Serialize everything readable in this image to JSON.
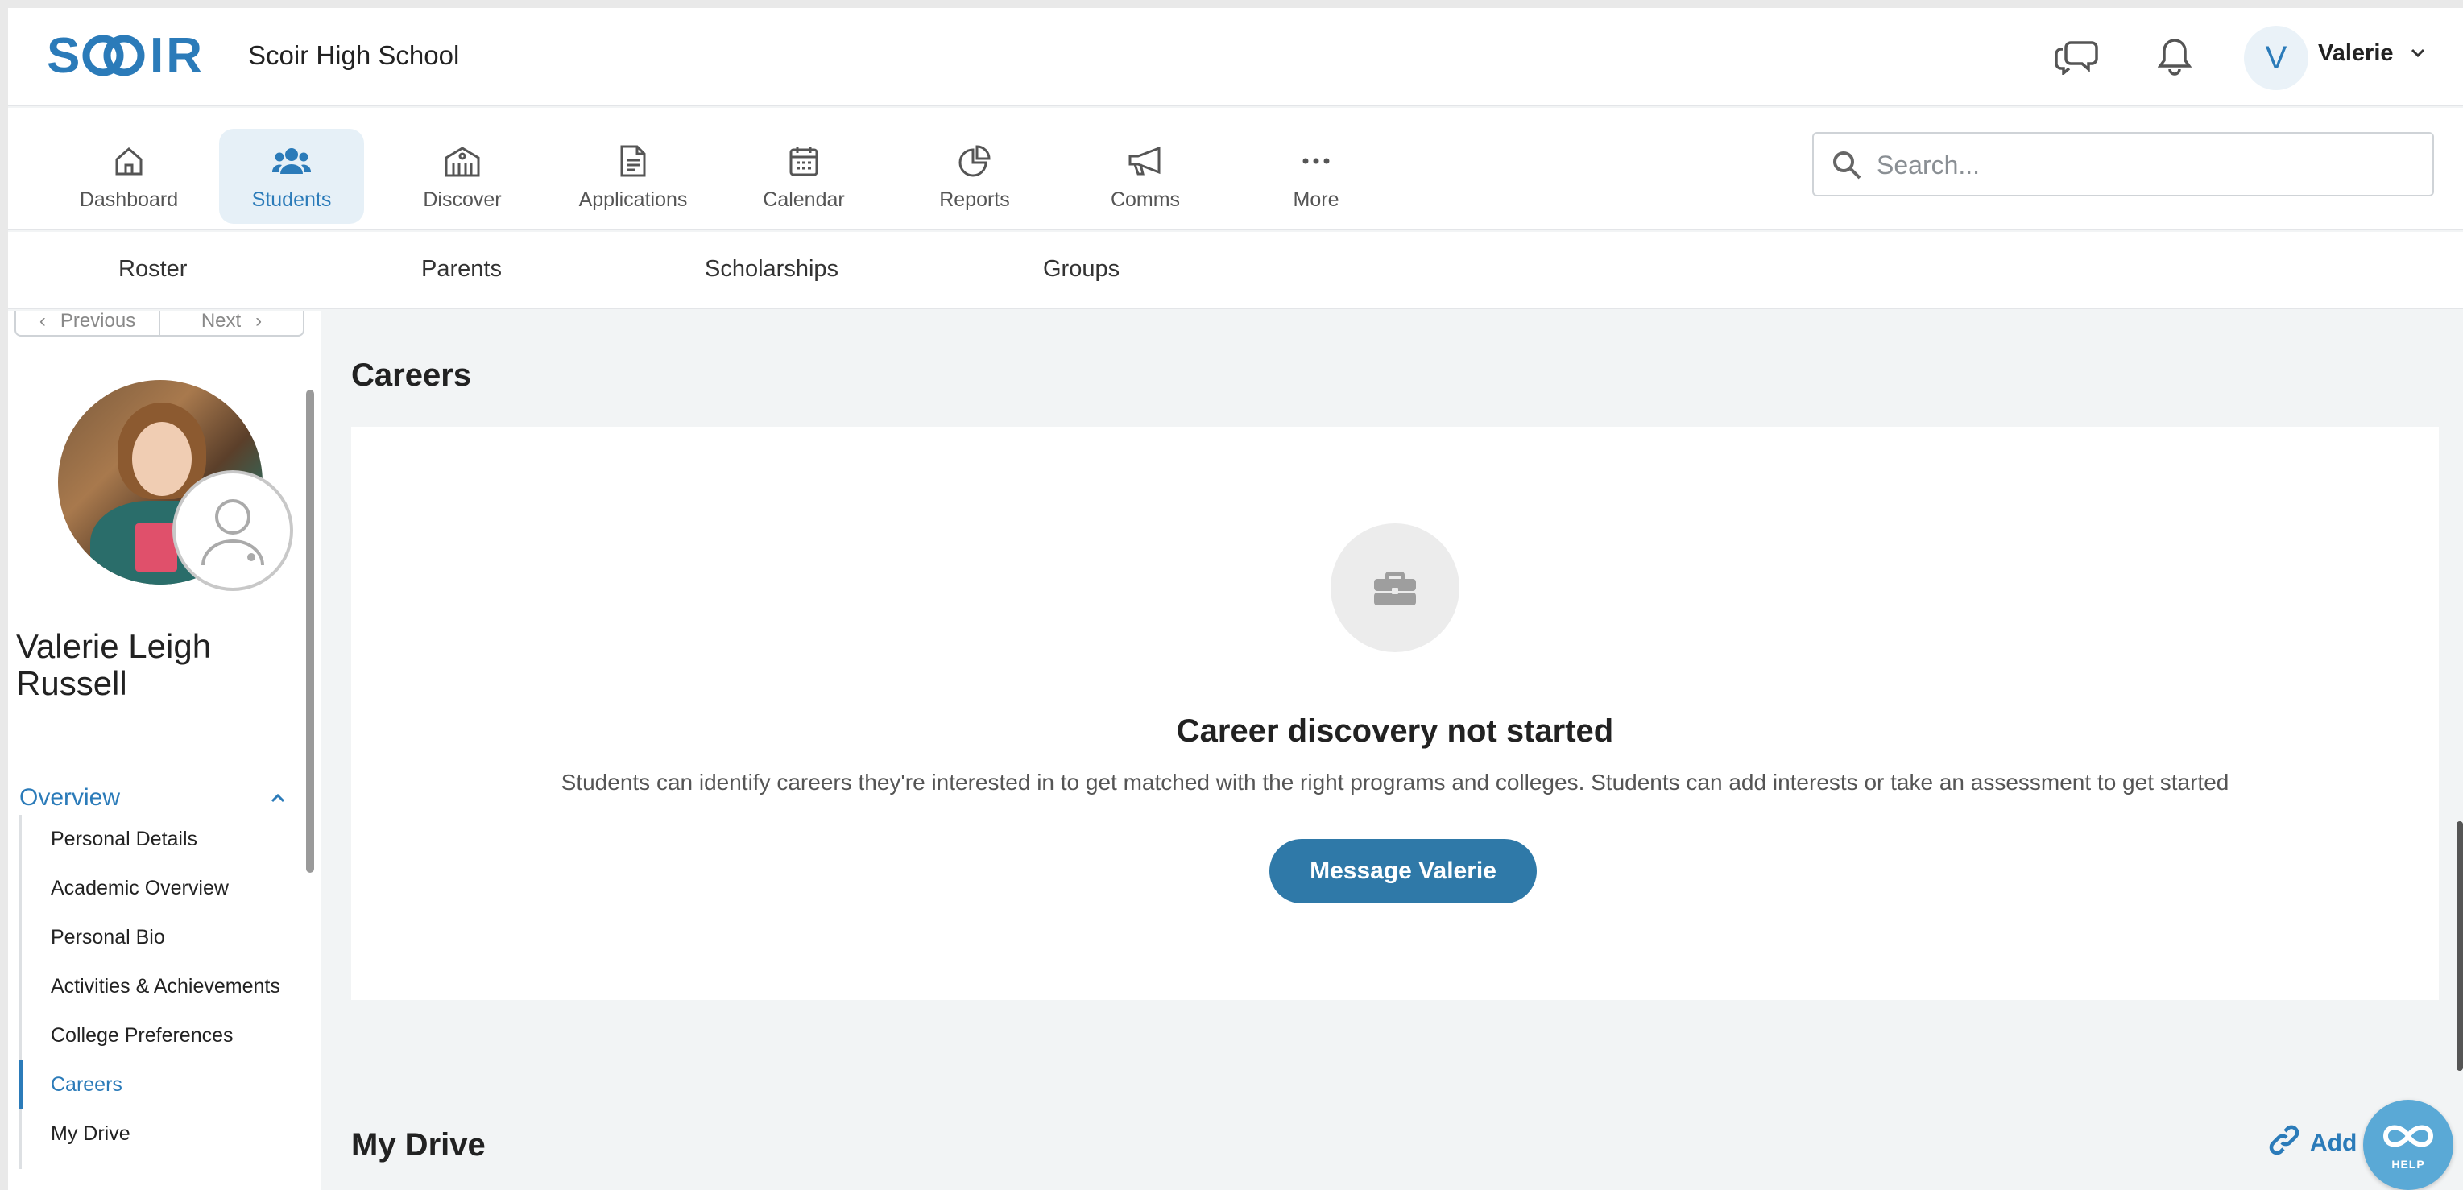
{
  "header": {
    "logo_text": "SCOIR",
    "school_name": "Scoir High School",
    "user_initial": "V",
    "user_name": "Valerie",
    "icons": [
      "chat-bubbles-icon",
      "bell-icon",
      "chevron-down-icon"
    ]
  },
  "nav": {
    "items": [
      {
        "label": "Dashboard",
        "icon": "home-icon",
        "active": false
      },
      {
        "label": "Students",
        "icon": "users-icon",
        "active": true
      },
      {
        "label": "Discover",
        "icon": "building-icon",
        "active": false
      },
      {
        "label": "Applications",
        "icon": "document-icon",
        "active": false
      },
      {
        "label": "Calendar",
        "icon": "calendar-icon",
        "active": false
      },
      {
        "label": "Reports",
        "icon": "pie-chart-icon",
        "active": false
      },
      {
        "label": "Comms",
        "icon": "megaphone-icon",
        "active": false
      },
      {
        "label": "More",
        "icon": "ellipsis-icon",
        "active": false
      }
    ],
    "search_placeholder": "Search..."
  },
  "subnav": {
    "items": [
      "Roster",
      "Parents",
      "Scholarships",
      "Groups"
    ]
  },
  "sidebar": {
    "pager": {
      "previous": "Previous",
      "next": "Next"
    },
    "student_name": "Valerie Leigh Russell",
    "overview_label": "Overview",
    "items": [
      {
        "label": "Personal Details",
        "active": false
      },
      {
        "label": "Academic Overview",
        "active": false
      },
      {
        "label": "Personal Bio",
        "active": false
      },
      {
        "label": "Activities & Achievements",
        "active": false
      },
      {
        "label": "College Preferences",
        "active": false
      },
      {
        "label": "Careers",
        "active": true
      },
      {
        "label": "My Drive",
        "active": false
      }
    ]
  },
  "main": {
    "careers_title": "Careers",
    "empty_state": {
      "icon": "briefcase-icon",
      "title": "Career discovery not started",
      "description": "Students can identify careers they're interested in to get matched with the right programs and colleges. Students can add interests or take an assessment to get started",
      "button_label": "Message Valerie"
    },
    "drive_title": "My Drive",
    "add_link_label": "Add a"
  },
  "help": {
    "label": "HELP"
  },
  "colors": {
    "accent": "#2b7bb9",
    "button": "#2f79a8",
    "background": "#f2f4f5"
  }
}
